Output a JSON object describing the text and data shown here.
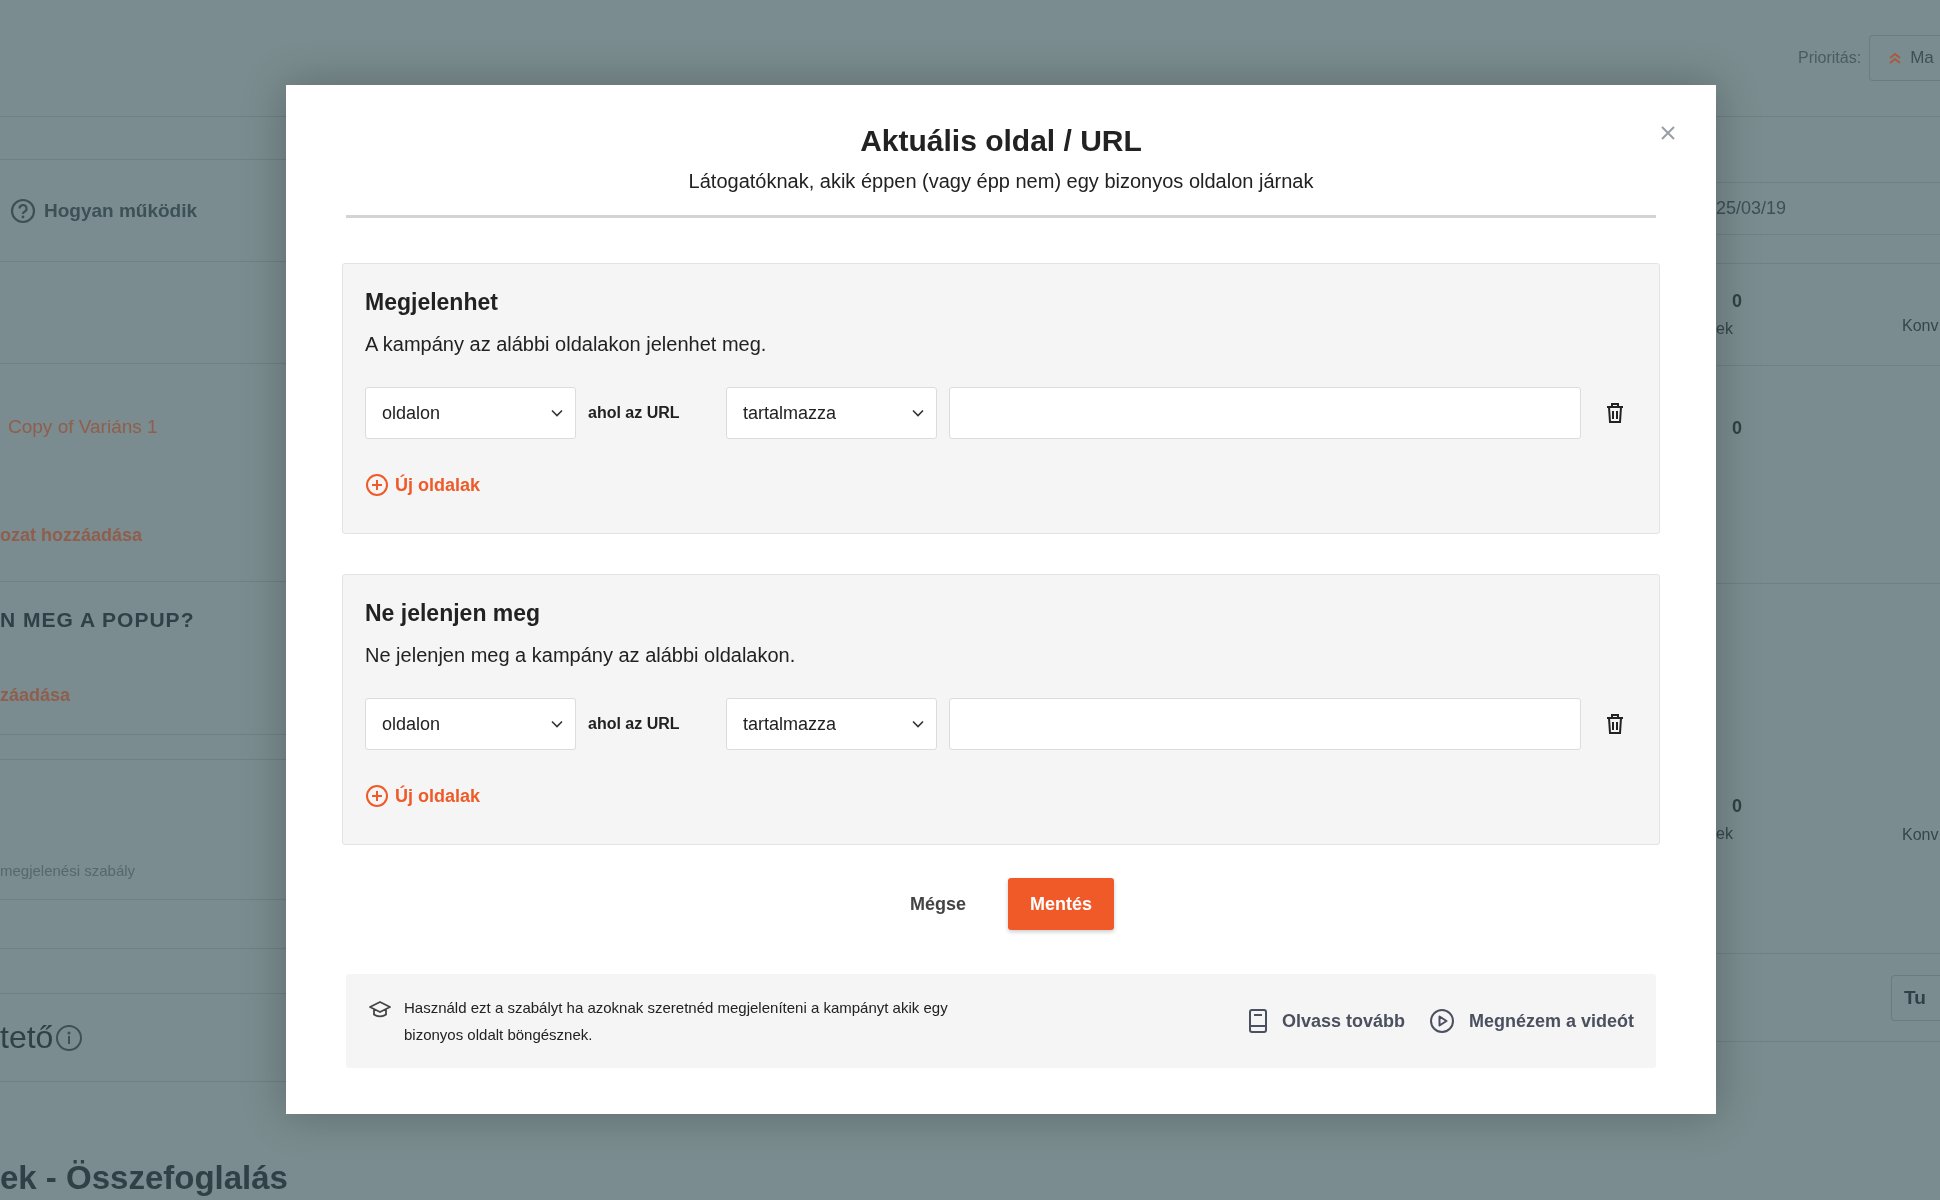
{
  "background": {
    "priority_label": "Prioritás:",
    "priority_button": "Ma",
    "help_link": "Hogyan működik",
    "date": "25/03/19",
    "variant": "Copy of Variáns 1",
    "add_link_1": "ozat hozzáadása",
    "section_heading": "N MEG A POPUP?",
    "add_link_2": "záadása",
    "rule_note": "megjelenési szabály",
    "title_fragment": "tető",
    "button_fragment": "Tu",
    "summary_title": "ek - Összefoglalás",
    "stats": [
      {
        "value": "0",
        "label": "ek",
        "label_2": "Konv"
      },
      {
        "value": "0"
      },
      {
        "value": "0",
        "label": "ek",
        "label_2": "Konv"
      }
    ]
  },
  "modal": {
    "title": "Aktuális oldal / URL",
    "subtitle": "Látogatóknak, akik éppen (vagy épp nem) egy bizonyos oldalon járnak",
    "sections": [
      {
        "title": "Megjelenhet",
        "description": "A kampány az alábbi oldalakon jelenhet meg.",
        "rules": [
          {
            "scope": "oldalon",
            "connector": "ahol az URL",
            "operator": "tartalmazza"
          }
        ],
        "add_label": "Új oldalak"
      },
      {
        "title": "Ne jelenjen meg",
        "description": "Ne jelenjen meg a kampány az alábbi oldalakon.",
        "rules": [
          {
            "scope": "oldalon",
            "connector": "ahol az URL",
            "operator": "tartalmazza"
          }
        ],
        "add_label": "Új oldalak"
      }
    ],
    "cancel": "Mégse",
    "save": "Mentés",
    "info": {
      "text": "Használd ezt a szabályt ha azoknak szeretnéd megjeleníteni a kampányt akik egy bizonyos oldalt böngésznek.",
      "links": [
        {
          "kind": "read",
          "label": "Olvass tovább"
        },
        {
          "kind": "video",
          "label": "Megnézem a videót"
        }
      ]
    }
  }
}
